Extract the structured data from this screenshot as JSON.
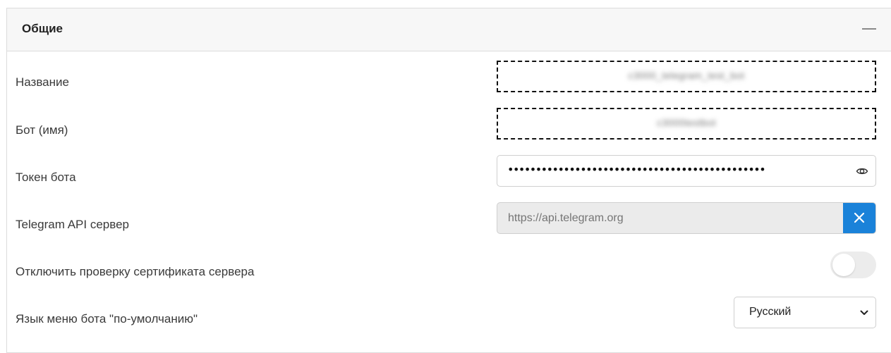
{
  "section": {
    "title": "Общие",
    "collapse_symbol": "—"
  },
  "fields": {
    "name": {
      "label": "Название",
      "value": "c3000_telegram_test_bot"
    },
    "bot_name": {
      "label": "Бот (имя)",
      "value": "c3000testbot"
    },
    "token": {
      "label": "Токен бота",
      "masked_value": "••••••••••••••••••••••••••••••••••••••••••••••"
    },
    "api_server": {
      "label": "Telegram API сервер",
      "placeholder": "https://api.telegram.org",
      "value": ""
    },
    "disable_cert_check": {
      "label": "Отключить проверку сертификата сервера",
      "enabled": false
    },
    "default_language": {
      "label": "Язык меню бота \"по-умолчанию\"",
      "selected": "Русский"
    }
  },
  "colors": {
    "accent": "#1a82d9",
    "header_bg": "#f7f7f7",
    "disabled_bg": "#ebebeb"
  },
  "icons": {
    "collapse": "minus-icon",
    "reveal_token": "eye-icon",
    "clear_url": "close-icon",
    "select_arrow": "chevron-down-icon"
  }
}
